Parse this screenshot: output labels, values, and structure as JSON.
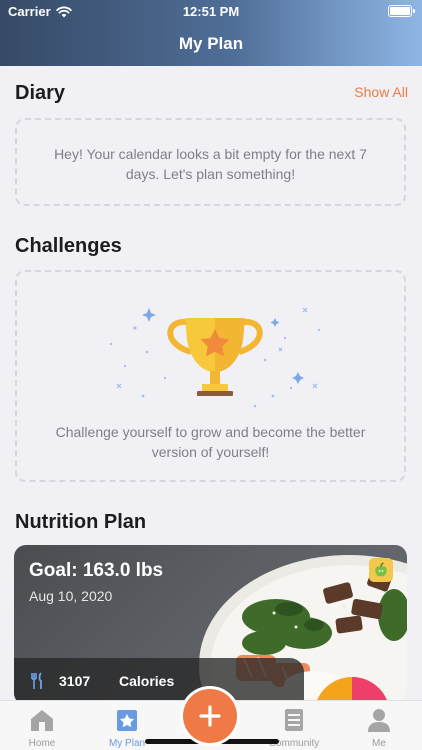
{
  "status_bar": {
    "carrier": "Carrier",
    "time": "12:51 PM"
  },
  "header": {
    "title": "My Plan"
  },
  "diary": {
    "heading": "Diary",
    "show_all_label": "Show All",
    "empty_message": "Hey! Your calendar looks a bit empty for the next 7 days. Let's plan something!"
  },
  "challenges": {
    "heading": "Challenges",
    "empty_message": "Challenge yourself to grow and become the better version of yourself!"
  },
  "nutrition": {
    "heading": "Nutrition Plan",
    "goal": "Goal: 163.0 lbs",
    "date": "Aug 10, 2020",
    "calories_value": "3107",
    "calories_label": "Calories"
  },
  "tabs": [
    {
      "label": "Home",
      "icon": "home-icon"
    },
    {
      "label": "My Plan",
      "icon": "plan-icon"
    },
    {
      "label": "Community",
      "icon": "community-icon"
    },
    {
      "label": "Me",
      "icon": "profile-icon"
    }
  ],
  "colors": {
    "accent": "#f07a45",
    "tab_active": "#6a9be0",
    "header_start": "#364a66",
    "header_end": "#8fb6e6"
  }
}
